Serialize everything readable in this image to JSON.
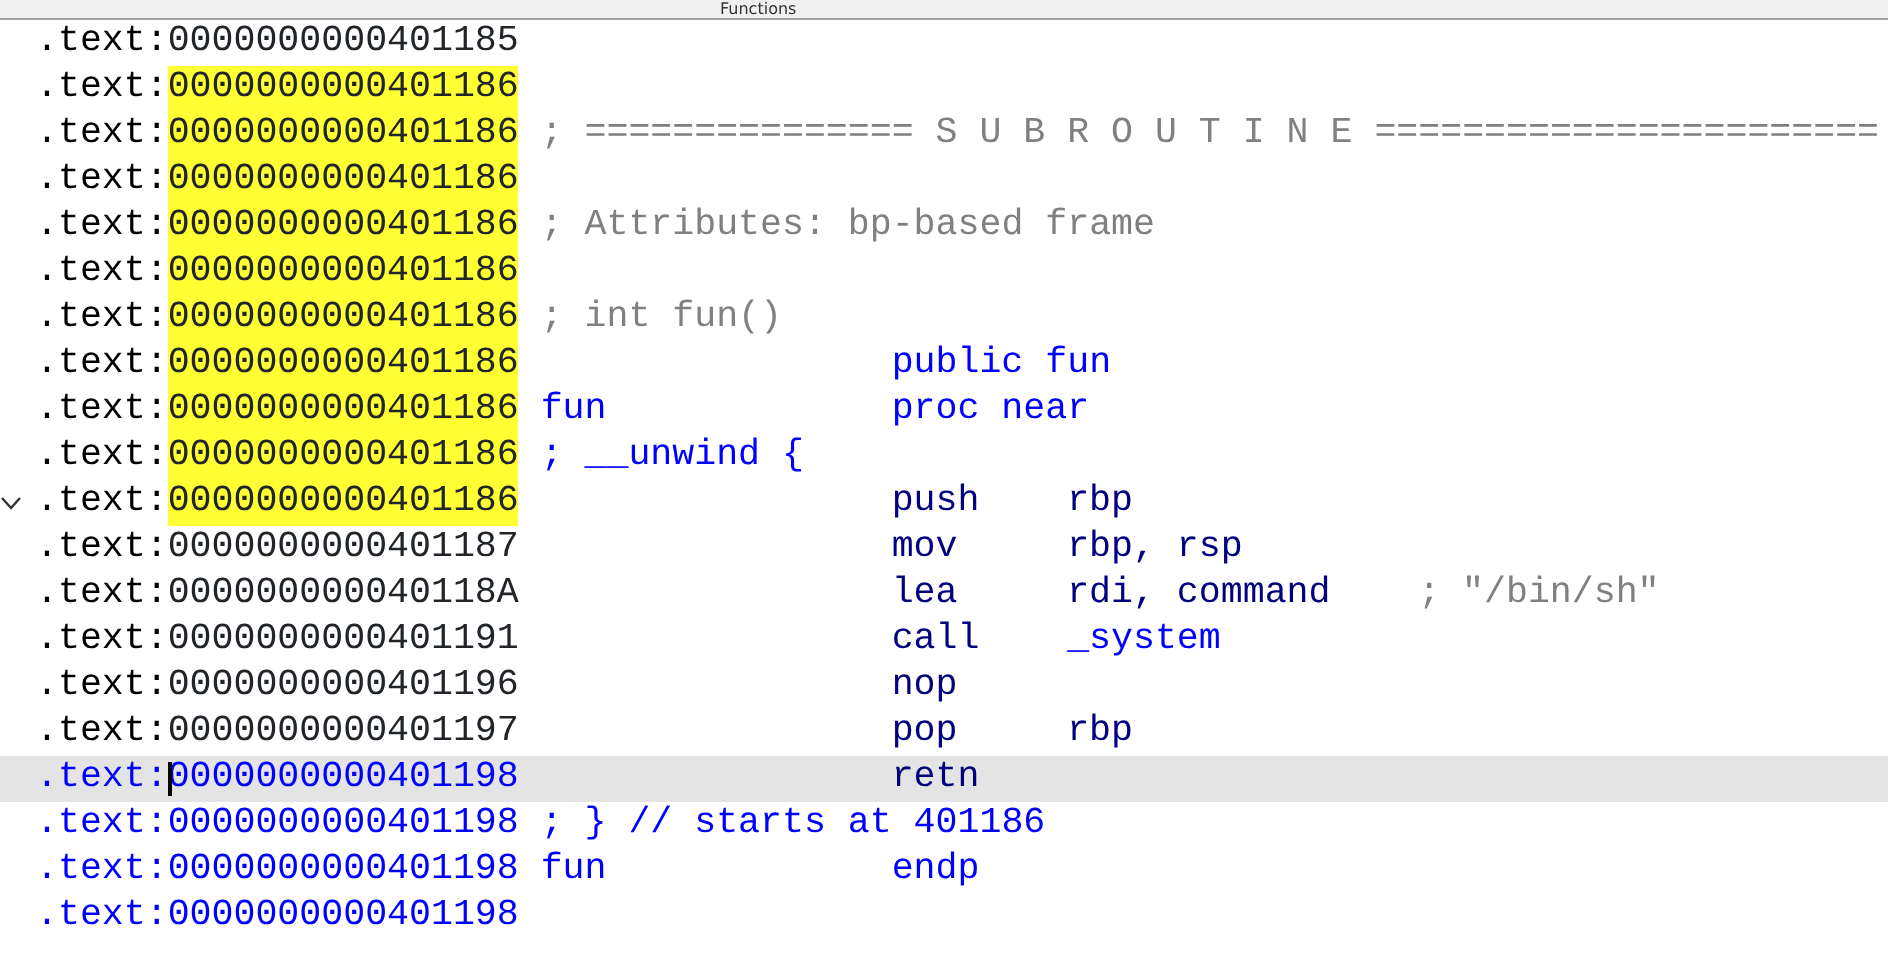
{
  "window": {
    "title": "Functions"
  },
  "listing": [
    {
      "segment": ".text:",
      "address": "0000000000401185",
      "highlighted": false,
      "selected": false,
      "kind": "body"
    },
    {
      "segment": ".text:",
      "address": "0000000000401186",
      "highlighted": true,
      "selected": false,
      "kind": "body"
    },
    {
      "segment": ".text:",
      "address": "0000000000401186",
      "highlighted": true,
      "selected": false,
      "kind": "body",
      "label": {
        "text": "; =============== S U B R O U T I N E =======================",
        "kind": "comment"
      }
    },
    {
      "segment": ".text:",
      "address": "0000000000401186",
      "highlighted": true,
      "selected": false,
      "kind": "body"
    },
    {
      "segment": ".text:",
      "address": "0000000000401186",
      "highlighted": true,
      "selected": false,
      "kind": "body",
      "label": {
        "text": "; Attributes: bp-based frame",
        "kind": "comment"
      }
    },
    {
      "segment": ".text:",
      "address": "0000000000401186",
      "highlighted": true,
      "selected": false,
      "kind": "body"
    },
    {
      "segment": ".text:",
      "address": "0000000000401186",
      "highlighted": true,
      "selected": false,
      "kind": "body",
      "label": {
        "text": "; int fun()",
        "kind": "comment"
      }
    },
    {
      "segment": ".text:",
      "address": "0000000000401186",
      "highlighted": true,
      "selected": false,
      "kind": "body",
      "mnemonic": {
        "text": "public fun",
        "kind": "directive"
      }
    },
    {
      "segment": ".text:",
      "address": "0000000000401186",
      "highlighted": true,
      "selected": false,
      "kind": "body",
      "label": {
        "text": "fun",
        "kind": "name"
      },
      "mnemonic": {
        "text": "proc near",
        "kind": "directive"
      }
    },
    {
      "segment": ".text:",
      "address": "0000000000401186",
      "highlighted": true,
      "selected": false,
      "kind": "body",
      "label": {
        "text": "; __unwind {",
        "kind": "name"
      }
    },
    {
      "segment": ".text:",
      "address": "0000000000401186",
      "highlighted": true,
      "selected": false,
      "kind": "body",
      "expanded": true,
      "mnemonic": {
        "text": "push",
        "kind": "instruction"
      },
      "operands": {
        "text": "rbp",
        "kind": "register"
      }
    },
    {
      "segment": ".text:",
      "address": "0000000000401187",
      "highlighted": false,
      "selected": false,
      "kind": "body",
      "mnemonic": {
        "text": "mov",
        "kind": "instruction"
      },
      "operands": {
        "text": "rbp, rsp",
        "kind": "register"
      }
    },
    {
      "segment": ".text:",
      "address": "000000000040118A",
      "highlighted": false,
      "selected": false,
      "kind": "body",
      "mnemonic": {
        "text": "lea",
        "kind": "instruction"
      },
      "operands": {
        "text": "rdi, command",
        "kind": "register"
      },
      "comment": "; \"/bin/sh\""
    },
    {
      "segment": ".text:",
      "address": "0000000000401191",
      "highlighted": false,
      "selected": false,
      "kind": "body",
      "mnemonic": {
        "text": "call",
        "kind": "instruction"
      },
      "operands": {
        "text": "_system",
        "kind": "name"
      }
    },
    {
      "segment": ".text:",
      "address": "0000000000401196",
      "highlighted": false,
      "selected": false,
      "kind": "body",
      "mnemonic": {
        "text": "nop",
        "kind": "instruction"
      }
    },
    {
      "segment": ".text:",
      "address": "0000000000401197",
      "highlighted": false,
      "selected": false,
      "kind": "body",
      "mnemonic": {
        "text": "pop",
        "kind": "instruction"
      },
      "operands": {
        "text": "rbp",
        "kind": "register"
      }
    },
    {
      "segment": ".text:",
      "address": "0000000000401198",
      "highlighted": false,
      "selected": true,
      "kind": "end",
      "mnemonic": {
        "text": "retn",
        "kind": "instruction"
      }
    },
    {
      "segment": ".text:",
      "address": "0000000000401198",
      "highlighted": false,
      "selected": false,
      "kind": "end",
      "label": {
        "text": "; } // starts at 401186",
        "kind": "name"
      }
    },
    {
      "segment": ".text:",
      "address": "0000000000401198",
      "highlighted": false,
      "selected": false,
      "kind": "end",
      "label": {
        "text": "fun",
        "kind": "name"
      },
      "mnemonic": {
        "text": "endp",
        "kind": "directive"
      }
    },
    {
      "segment": ".text:",
      "address": "0000000000401198",
      "highlighted": false,
      "selected": false,
      "kind": "end"
    }
  ]
}
